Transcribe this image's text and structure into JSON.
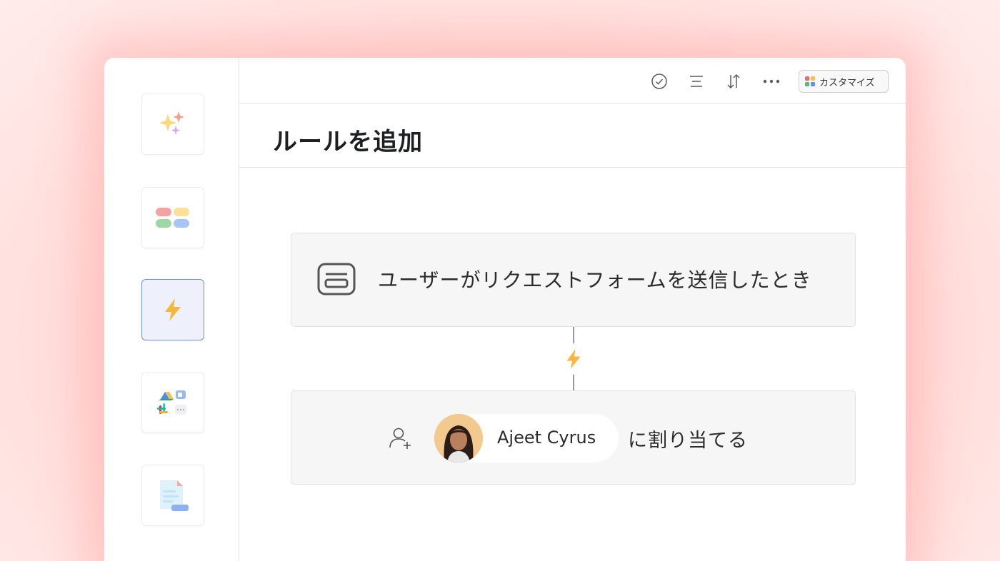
{
  "toolbar": {
    "icons": [
      "check-circle-icon",
      "filter-icon",
      "sort-icon",
      "more-icon"
    ],
    "customize_label": "カスタマイズ",
    "colors": {
      "grid_red": "#f06a6a",
      "grid_yellow": "#f8c14e",
      "grid_green": "#5fb67c",
      "grid_blue": "#6a8ff0"
    }
  },
  "page": {
    "title": "ルールを追加"
  },
  "sidebar": {
    "items": [
      {
        "name": "ai-sparkle",
        "icon": "sparkles-icon"
      },
      {
        "name": "fields",
        "icon": "fields-icon"
      },
      {
        "name": "rules",
        "icon": "lightning-icon",
        "active": true
      },
      {
        "name": "apps",
        "icon": "apps-icon"
      },
      {
        "name": "forms",
        "icon": "form-doc-icon"
      }
    ]
  },
  "rule": {
    "trigger_text": "ユーザーがリクエストフォームを送信したとき",
    "action": {
      "assignee_name": "Ajeet Cyrus",
      "action_text": "に割り当てる"
    }
  },
  "colors": {
    "accent_border": "#6f8fe0",
    "active_bg": "#eef0fc",
    "bolt": "#f6b73c"
  }
}
